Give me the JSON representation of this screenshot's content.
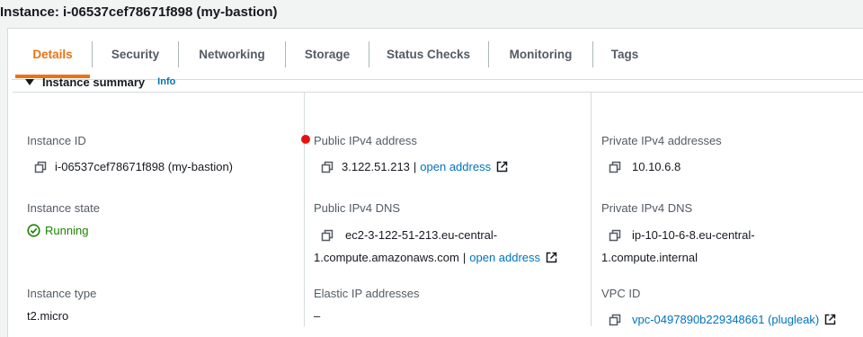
{
  "header": {
    "title": "Instance: i-06537cef78671f898 (my-bastion)"
  },
  "tabs": [
    {
      "label": "Details",
      "active": true
    },
    {
      "label": "Security",
      "active": false
    },
    {
      "label": "Networking",
      "active": false
    },
    {
      "label": "Storage",
      "active": false
    },
    {
      "label": "Status Checks",
      "active": false
    },
    {
      "label": "Monitoring",
      "active": false
    },
    {
      "label": "Tags",
      "active": false
    }
  ],
  "summary": {
    "title": "Instance summary",
    "info_link": "Info",
    "instance_id": {
      "label": "Instance ID",
      "value": "i-06537cef78671f898 (my-bastion)"
    },
    "public_ipv4": {
      "label": "Public IPv4 address",
      "value": "3.122.51.213",
      "separator": "|",
      "link": "open address"
    },
    "private_ipv4": {
      "label": "Private IPv4 addresses",
      "value": "10.10.6.8"
    },
    "instance_state": {
      "label": "Instance state",
      "value": "Running"
    },
    "public_dns": {
      "label": "Public IPv4 DNS",
      "line1": "ec2-3-122-51-213.eu-central-",
      "line2": "1.compute.amazonaws.com",
      "separator": "|",
      "link": "open address"
    },
    "private_dns": {
      "label": "Private IPv4 DNS",
      "line1": "ip-10-10-6-8.eu-central-",
      "line2": "1.compute.internal"
    },
    "instance_type": {
      "label": "Instance type",
      "value": "t2.micro"
    },
    "elastic_ip": {
      "label": "Elastic IP addresses",
      "value": "–"
    },
    "vpc_id": {
      "label": "VPC ID",
      "value": "vpc-0497890b229348661 (plugleak)"
    }
  },
  "colors": {
    "accent": "#ec7211",
    "link": "#0073bb",
    "success": "#1d8102",
    "alert_dot": "#e8110e"
  },
  "icons": {
    "copy": "copy-icon",
    "external": "external-link-icon",
    "status": "check-circle-icon",
    "expand": "caret-down-icon"
  }
}
